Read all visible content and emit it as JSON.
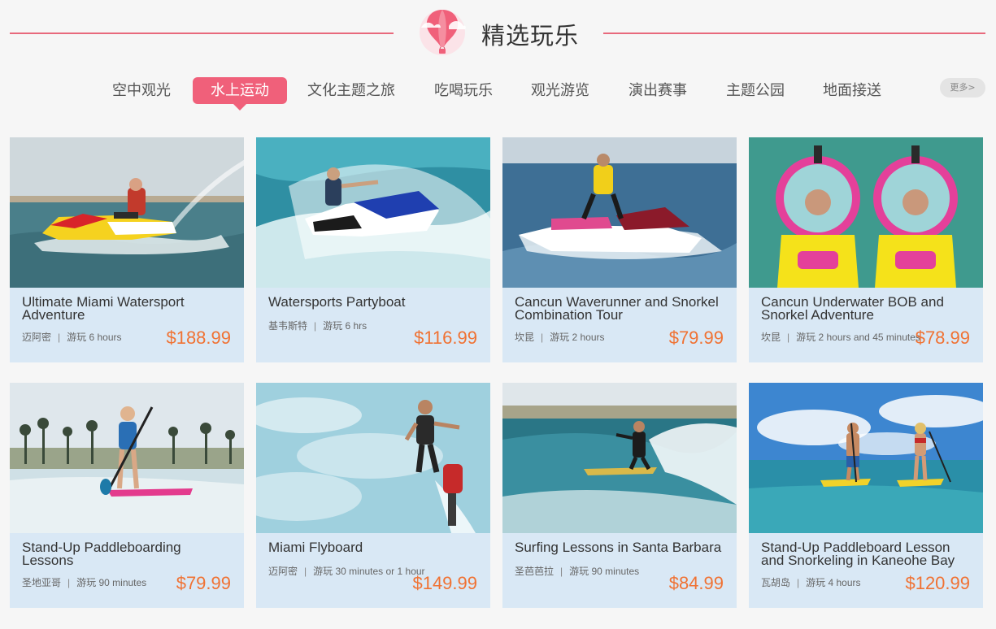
{
  "header": {
    "title": "精选玩乐",
    "accent_color": "#e8697c",
    "logo_icon": "hot-air-balloon-icon"
  },
  "tabs": [
    {
      "label": "空中观光",
      "active": false
    },
    {
      "label": "水上运动",
      "active": true
    },
    {
      "label": "文化主题之旅",
      "active": false
    },
    {
      "label": "吃喝玩乐",
      "active": false
    },
    {
      "label": "观光游览",
      "active": false
    },
    {
      "label": "演出赛事",
      "active": false
    },
    {
      "label": "主题公园",
      "active": false
    },
    {
      "label": "地面接送",
      "active": false
    }
  ],
  "more_label": "更多>",
  "price_color": "#f07233",
  "cards": [
    {
      "name": "Ultimate Miami Watersport Adventure",
      "location": "迈阿密",
      "duration": "游玩 6 hours",
      "price": "$188.99",
      "image": "jet-ski-yellow"
    },
    {
      "name": "Watersports Partyboat",
      "location": "基韦斯特",
      "duration": "游玩 6 hrs",
      "price": "$116.99",
      "image": "jet-ski-blue"
    },
    {
      "name": "Cancun Waverunner and Snorkel Combination Tour",
      "location": "坎昆",
      "duration": "游玩 2 hours",
      "price": "$79.99",
      "image": "waverunner-red"
    },
    {
      "name": "Cancun Underwater BOB and Snorkel Adventure",
      "location": "坎昆",
      "duration": "游玩 2 hours and 45 minutes",
      "price": "$78.99",
      "image": "underwater-bob"
    },
    {
      "name": "Stand-Up Paddleboarding Lessons",
      "location": "圣地亚哥",
      "duration": "游玩 90 minutes",
      "price": "$79.99",
      "image": "paddleboard-beach"
    },
    {
      "name": "Miami Flyboard",
      "location": "迈阿密",
      "duration": "游玩 30 minutes or 1 hour",
      "price": "$149.99",
      "image": "flyboard"
    },
    {
      "name": "Surfing Lessons in Santa Barbara",
      "location": "圣芭芭拉",
      "duration": "游玩 90 minutes",
      "price": "$84.99",
      "image": "surfing"
    },
    {
      "name": "Stand-Up Paddleboard Lesson and Snorkeling in Kaneohe Bay",
      "location": "瓦胡岛",
      "duration": "游玩 4 hours",
      "price": "$120.99",
      "image": "paddleboard-couple"
    }
  ]
}
